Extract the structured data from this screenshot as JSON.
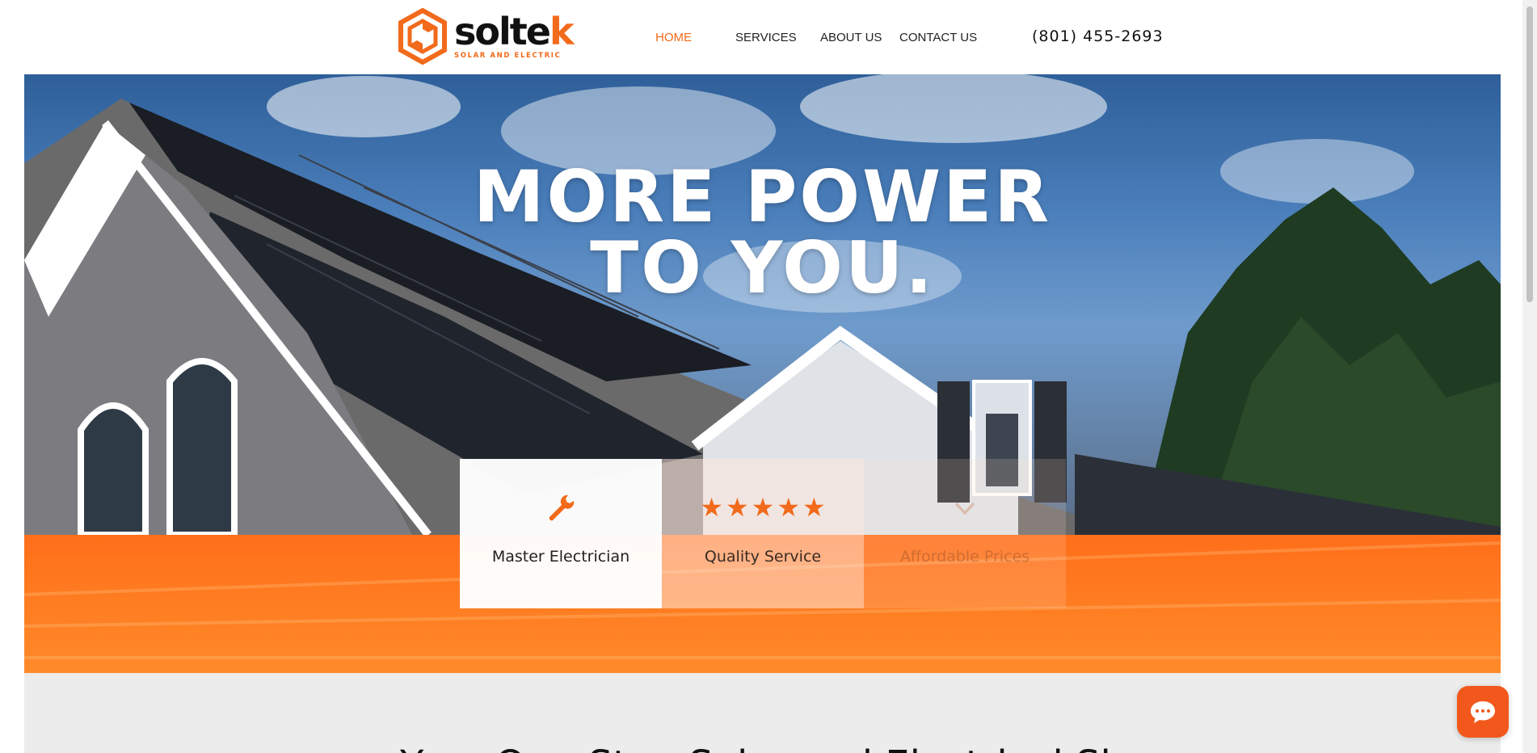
{
  "header": {
    "logo": {
      "name": "soltek",
      "tagline": "SOLAR AND ELECTRIC"
    },
    "nav": [
      {
        "label": "HOME",
        "active": true
      },
      {
        "label": "SERVICES",
        "active": false
      },
      {
        "label": "ABOUT US",
        "active": false
      },
      {
        "label": "CONTACT US",
        "active": false
      }
    ],
    "phone": "(801) 455-2693"
  },
  "hero": {
    "title_line1": "MORE POWER",
    "title_line2": "TO YOU."
  },
  "features": [
    {
      "label": "Master Electrician",
      "icon": "wrench-icon"
    },
    {
      "label": "Quality Service",
      "icon": "five-stars-icon",
      "stars": 5
    },
    {
      "label": "Affordable Prices",
      "icon": "price-icon"
    }
  ],
  "lower": {
    "heading": "Your One-Stop Solar and Electrical Sh"
  },
  "colors": {
    "accent": "#f26a1b",
    "band": "#ff7a20",
    "lower_bg": "#ececec"
  }
}
